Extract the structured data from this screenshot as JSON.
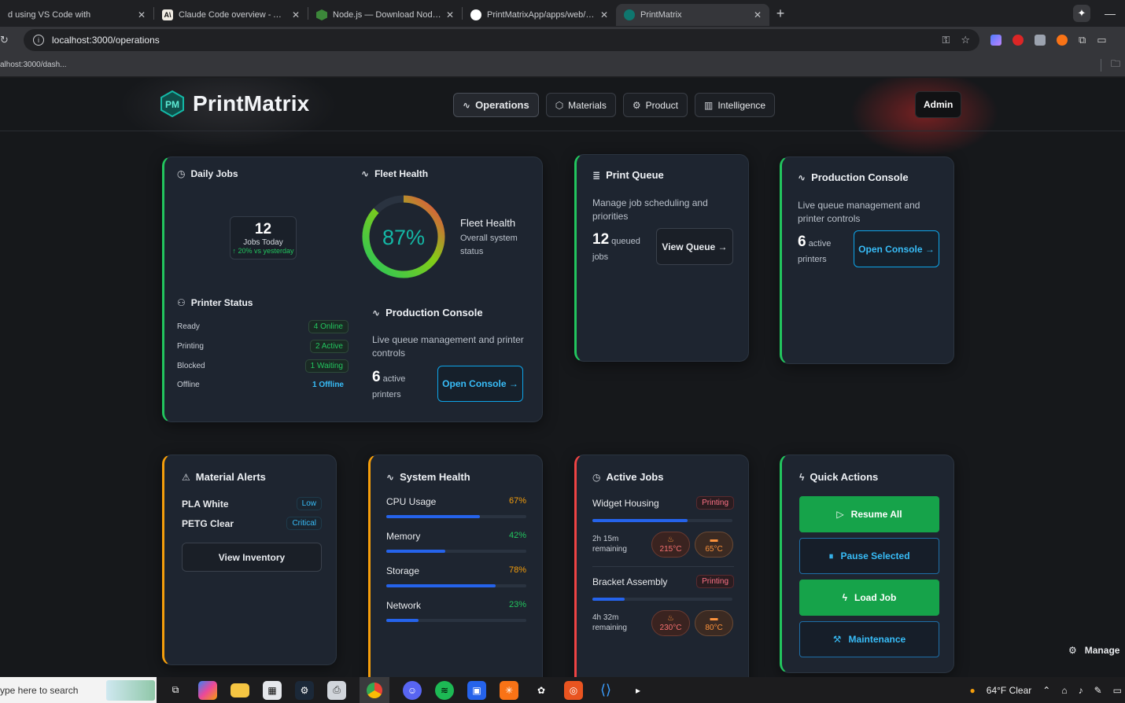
{
  "browser": {
    "tabs": [
      {
        "title": "d using VS Code with",
        "favicon": "vscode-icon"
      },
      {
        "title": "Claude Code overview - Anthro",
        "favicon": "anthropic-icon"
      },
      {
        "title": "Node.js — Download Node.js®",
        "favicon": "nodejs-icon"
      },
      {
        "title": "PrintMatrixApp/apps/web/app/",
        "favicon": "github-icon"
      },
      {
        "title": "PrintMatrix",
        "favicon": "printmatrix-icon",
        "active": true
      }
    ],
    "url": "localhost:3000/operations",
    "bookmark": "alhost:3000/dash..."
  },
  "app": {
    "brand": "PrintMatrix",
    "nav": [
      {
        "label": "Operations",
        "icon": "activity-icon",
        "active": true
      },
      {
        "label": "Materials",
        "icon": "box-icon"
      },
      {
        "label": "Product",
        "icon": "gear-icon"
      },
      {
        "label": "Intelligence",
        "icon": "chart-icon"
      }
    ],
    "admin_label": "Admin",
    "daily_jobs": {
      "title": "Daily Jobs",
      "count": "12",
      "label": "Jobs Today",
      "delta": "↑ 20% vs yesterday"
    },
    "fleet_health": {
      "title": "Fleet Health",
      "percent": 87,
      "percent_label": "87%",
      "heading": "Fleet Health",
      "subtitle": "Overall system status"
    },
    "printer_status": {
      "title": "Printer Status",
      "rows": [
        {
          "label": "Ready",
          "value": "4 Online",
          "style": "green"
        },
        {
          "label": "Printing",
          "value": "2 Active",
          "style": "green"
        },
        {
          "label": "Blocked",
          "value": "1 Waiting",
          "style": "green"
        },
        {
          "label": "Offline",
          "value": "1 Offline",
          "style": "blue"
        }
      ]
    },
    "production_console_inner": {
      "title": "Production Console",
      "desc": "Live queue management and printer controls",
      "count": "6",
      "unit": "active",
      "unit2": "printers",
      "button": "Open Console →"
    },
    "print_queue": {
      "title": "Print Queue",
      "desc": "Manage job scheduling and priorities",
      "count": "12",
      "unit": "queued",
      "unit2": "jobs",
      "button": "View Queue →"
    },
    "production_console": {
      "title": "Production Console",
      "desc": "Live queue management and printer controls",
      "count": "6",
      "unit": "active",
      "unit2": "printers",
      "button": "Open Console →"
    },
    "material_alerts": {
      "title": "Material Alerts",
      "items": [
        {
          "name": "PLA White",
          "status": "Low",
          "style": "blue"
        },
        {
          "name": "PETG Clear",
          "status": "Critical",
          "style": "blue"
        }
      ],
      "button": "View Inventory"
    },
    "system_health": {
      "title": "System Health",
      "metrics": [
        {
          "name": "CPU Usage",
          "value": "67%",
          "fraction": 0.67,
          "color": "#f59e0b"
        },
        {
          "name": "Memory",
          "value": "42%",
          "fraction": 0.42,
          "color": "#22c55e"
        },
        {
          "name": "Storage",
          "value": "78%",
          "fraction": 0.78,
          "color": "#f59e0b"
        },
        {
          "name": "Network",
          "value": "23%",
          "fraction": 0.23,
          "color": "#22c55e"
        }
      ]
    },
    "active_jobs": {
      "title": "Active Jobs",
      "jobs": [
        {
          "name": "Widget Housing",
          "status": "Printing",
          "progress": 0.68,
          "remaining": "2h 15m",
          "remaining_label": "remaining",
          "nozzle": "215°C",
          "bed": "65°C"
        },
        {
          "name": "Bracket Assembly",
          "status": "Printing",
          "progress": 0.23,
          "remaining": "4h 32m",
          "remaining_label": "remaining",
          "nozzle": "230°C",
          "bed": "80°C"
        }
      ]
    },
    "quick_actions": {
      "title": "Quick Actions",
      "buttons": [
        {
          "label": "Resume All",
          "icon": "play-icon",
          "style": "solid"
        },
        {
          "label": "Pause Selected",
          "icon": "pause-icon",
          "style": "outline"
        },
        {
          "label": "Load Job",
          "icon": "bolt-icon",
          "style": "solid"
        },
        {
          "label": "Maintenance",
          "icon": "wrench-icon",
          "style": "outline"
        }
      ]
    },
    "manage_label": "Manage"
  },
  "taskbar": {
    "search_placeholder": "ype here to search",
    "weather": "64°F  Clear"
  },
  "colors": {
    "accent_green": "#22c55e",
    "accent_cyan": "#38bdf8",
    "accent_amber": "#f59e0b",
    "accent_red": "#ef4444",
    "progress_blue": "#2563eb"
  }
}
